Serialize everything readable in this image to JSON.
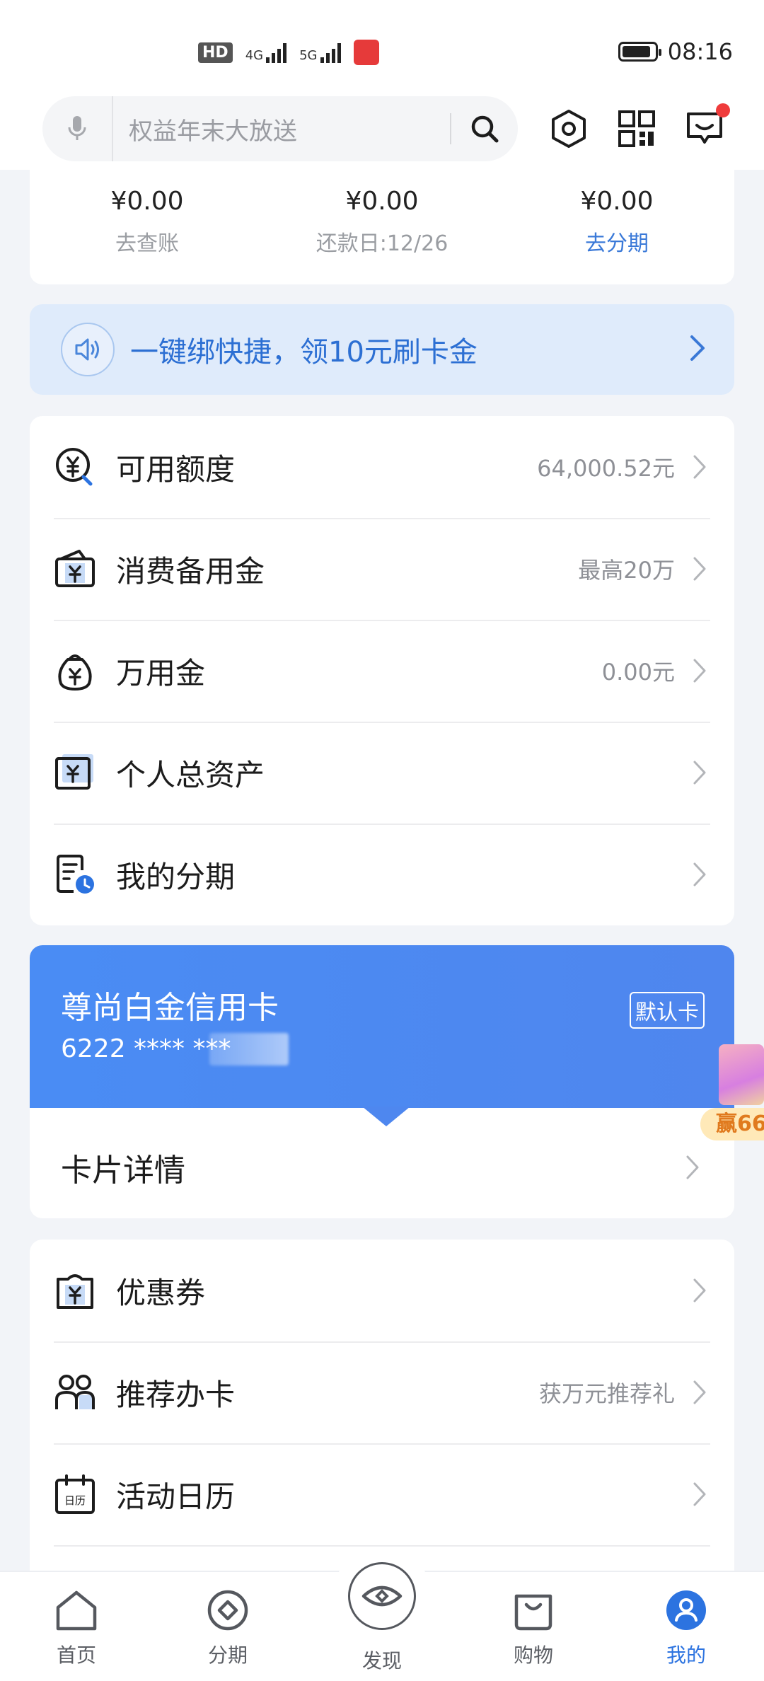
{
  "status_bar": {
    "hd_badge": "HD",
    "net1": "4G",
    "net2": "5G",
    "time": "08:16",
    "battery_level": 0.9
  },
  "search": {
    "placeholder": "权益年末大放送"
  },
  "summary": [
    {
      "amount": "¥0.00",
      "sub": "去查账"
    },
    {
      "amount": "¥0.00",
      "sub": "还款日:12/26"
    },
    {
      "amount": "¥0.00",
      "sub": "去分期"
    }
  ],
  "banner": {
    "text": "一键绑快捷，领10元刷卡金"
  },
  "menu1": [
    {
      "label": "可用额度",
      "value": "64,000.52元",
      "icon": "yuan-search-icon"
    },
    {
      "label": "消费备用金",
      "value": "最高20万",
      "icon": "wallet-icon"
    },
    {
      "label": "万用金",
      "value": "0.00元",
      "icon": "money-bag-icon"
    },
    {
      "label": "个人总资产",
      "value": "",
      "icon": "assets-icon"
    },
    {
      "label": "我的分期",
      "value": "",
      "icon": "installment-icon"
    }
  ],
  "credit_card": {
    "name": "尊尚白金信用卡",
    "number": "6222 **** ***",
    "badge": "默认卡",
    "detail": "卡片详情"
  },
  "promo": {
    "tag": "赢66"
  },
  "menu2": [
    {
      "label": "优惠券",
      "value": "",
      "icon": "coupon-icon"
    },
    {
      "label": "推荐办卡",
      "value": "获万元推荐礼",
      "icon": "refer-icon"
    },
    {
      "label": "活动日历",
      "value": "",
      "icon": "calendar-icon",
      "icon_text": "日历"
    }
  ],
  "bottom_nav": [
    {
      "label": "首页",
      "icon": "home-icon"
    },
    {
      "label": "分期",
      "icon": "installment-nav-icon"
    },
    {
      "label": "发现",
      "icon": "discover-icon"
    },
    {
      "label": "购物",
      "icon": "shopping-bag-icon"
    },
    {
      "label": "我的",
      "icon": "profile-icon"
    }
  ],
  "colors": {
    "accent": "#2c73e0",
    "card_blue": "#4a8cf4",
    "banner_bg": "#dfebfb"
  }
}
